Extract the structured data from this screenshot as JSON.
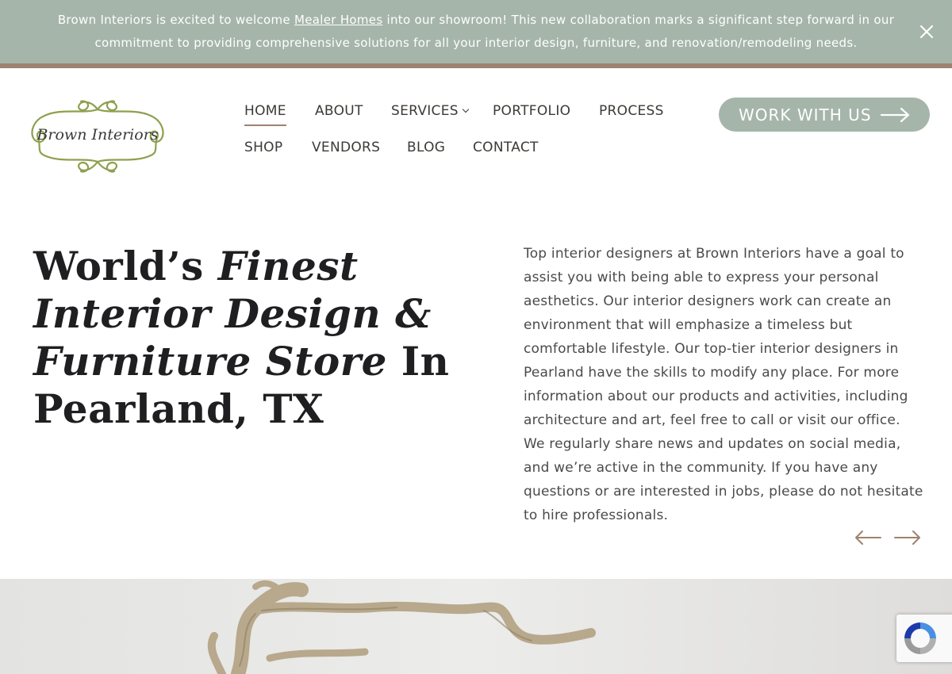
{
  "announcement": {
    "text_before": "Brown Interiors is excited to welcome ",
    "link_text": "Mealer Homes",
    "text_after": " into our showroom!  This new collaboration marks a significant step forward in our commitment to providing comprehensive solutions for all your interior design, furniture, and renovation/remodeling needs.",
    "close_icon": "close-icon"
  },
  "logo": {
    "text": "Brown Interiors"
  },
  "nav": {
    "items": [
      {
        "label": "HOME",
        "active": true
      },
      {
        "label": "ABOUT"
      },
      {
        "label": "SERVICES",
        "has_dropdown": true
      },
      {
        "label": "PORTFOLIO"
      },
      {
        "label": "PROCESS"
      },
      {
        "label": "SHOP"
      },
      {
        "label": "VENDORS"
      },
      {
        "label": "BLOG"
      },
      {
        "label": "CONTACT"
      }
    ]
  },
  "cta": {
    "label": "WORK WITH US",
    "icon": "arrow-right-icon"
  },
  "hero": {
    "title_part1": "World’s ",
    "title_italic": "Finest Interior Design & Furniture Store",
    "title_part2": " In Pearland, TX",
    "body": "Top interior designers at Brown Interiors have a goal to assist you with being able to express your personal aesthetics. Our interior designers work can create an environment that will emphasize a timeless but comfortable lifestyle. Our top-tier interior designers in Pearland have the skills to modify any place. For more information about our products and activities, including architecture and art, feel free to call or visit our office. We regularly share news and updates on social media, and we’re active in the community. If you have any questions or are interested in jobs, please do not hesitate to hire professionals."
  },
  "slider": {
    "prev_icon": "arrow-left-icon",
    "next_icon": "arrow-right-icon"
  },
  "colors": {
    "announcement_bg": "#a5b5aa",
    "accent_brown": "#9f8170",
    "logo_green": "#8ea04e",
    "heading_text": "#1f1f22"
  }
}
